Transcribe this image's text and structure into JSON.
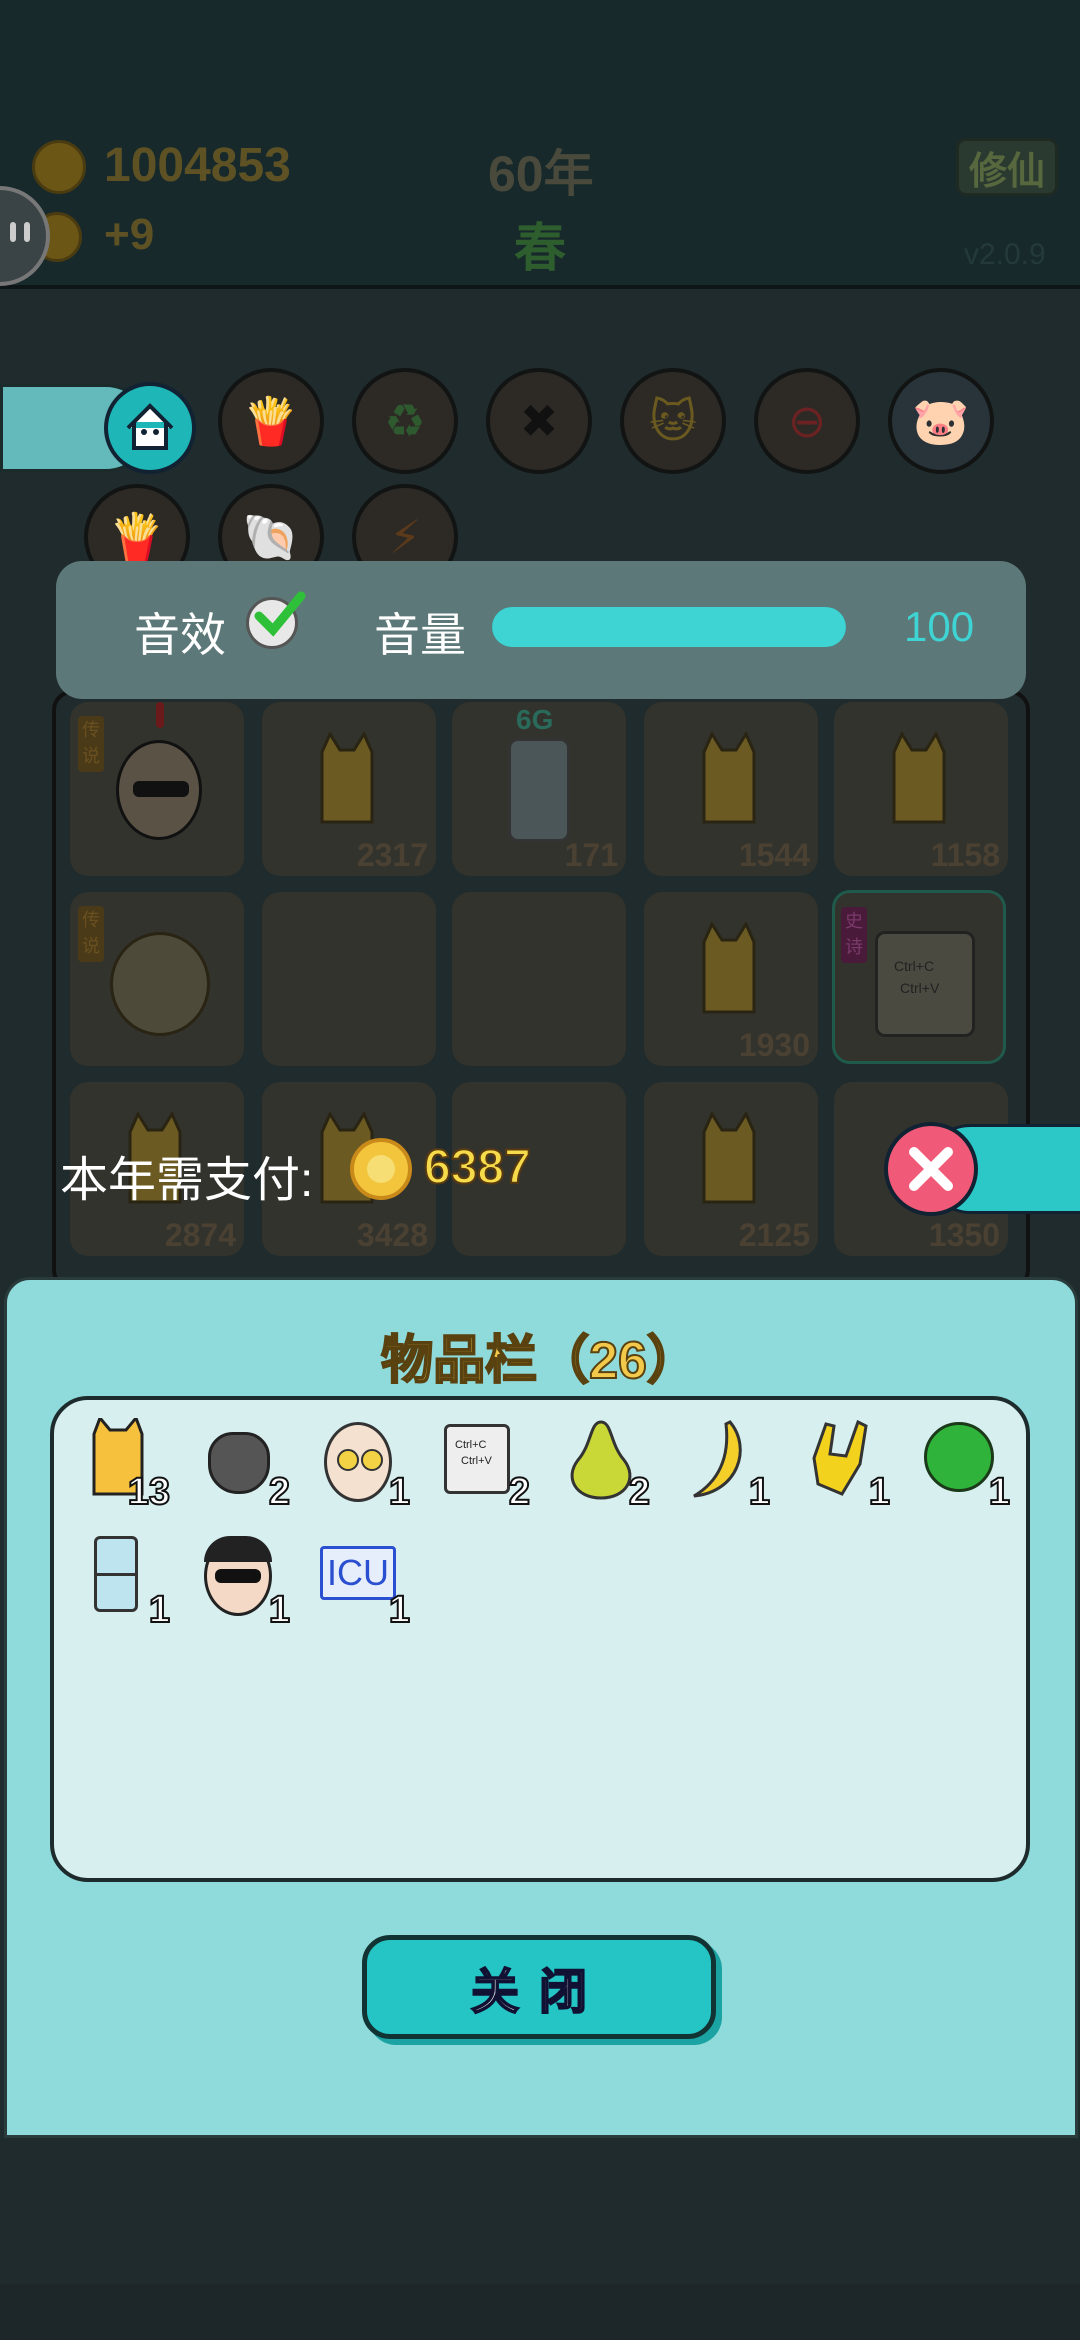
{
  "header": {
    "coins": "1004853",
    "income": "+9",
    "year": "60年",
    "season": "春",
    "mode_button": "修仙",
    "version": "v2.0.9"
  },
  "board": {
    "cell_numbers": [
      "2317",
      "171",
      "1544",
      "1158",
      "1930",
      "2874",
      "3428",
      "2125",
      "1350"
    ],
    "tag_legend": "传说",
    "tag_epic": "史诗",
    "fridge_label": "6G",
    "ctrl_label_1": "Ctrl+C",
    "ctrl_label_2": "Ctrl+V"
  },
  "settings": {
    "sfx_label": "音效",
    "sfx_enabled": true,
    "volume_label": "音量",
    "volume_value": "100",
    "volume_level": 1.0
  },
  "payment": {
    "label": "本年需支付:",
    "amount": "6387"
  },
  "inventory": {
    "title": "物品栏（26）",
    "items": [
      {
        "icon": "cat-icon",
        "qty": "13"
      },
      {
        "icon": "trash-bag-icon",
        "qty": "2"
      },
      {
        "icon": "old-man-face-icon",
        "qty": "1"
      },
      {
        "icon": "ctrl-c-ctrl-v-icon",
        "qty": "2",
        "text1": "Ctrl+C",
        "text2": "Ctrl+V"
      },
      {
        "icon": "pear-icon",
        "qty": "2"
      },
      {
        "icon": "banana-icon",
        "qty": "1"
      },
      {
        "icon": "rock-hand-icon",
        "qty": "1"
      },
      {
        "icon": "watermelon-icon",
        "qty": "1"
      },
      {
        "icon": "fridge-icon",
        "qty": "1"
      },
      {
        "icon": "sunglasses-man-icon",
        "qty": "1"
      },
      {
        "icon": "icu-icon",
        "qty": "1",
        "text": "ICU"
      }
    ],
    "close_label": "关闭"
  },
  "colors": {
    "accent": "#25c5c5",
    "coin_gold": "#f2c53d",
    "panel_bg": "#8fdada"
  }
}
